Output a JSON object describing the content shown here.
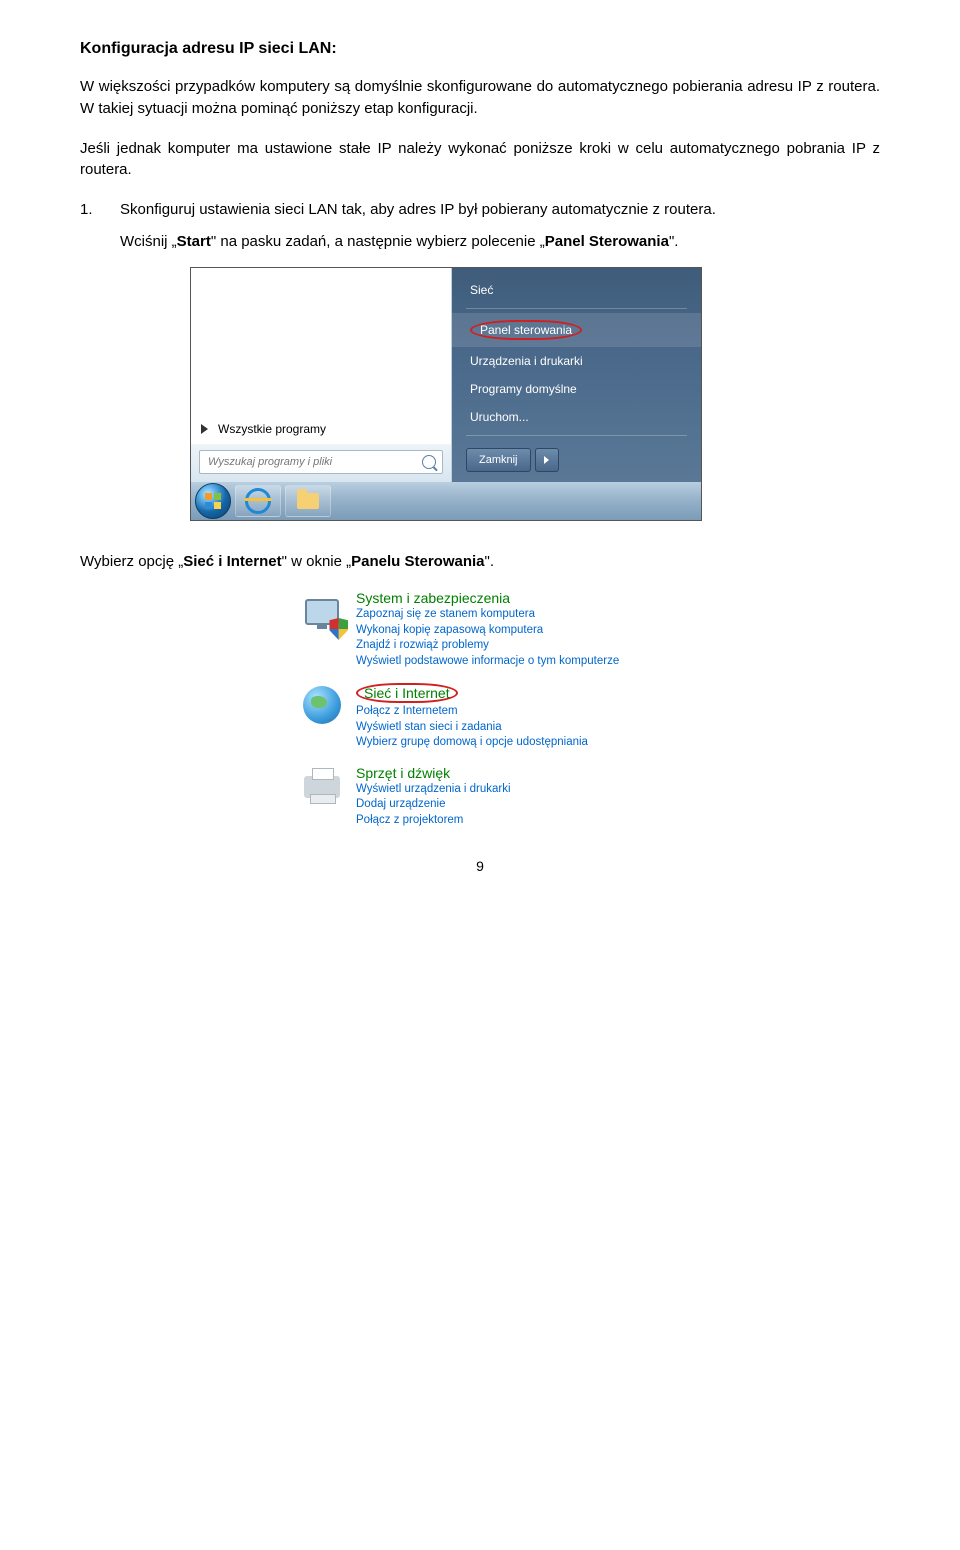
{
  "heading": "Konfiguracja adresu IP sieci LAN:",
  "para1": "W większości przypadków komputery są domyślnie skonfigurowane do automatycznego pobierania adresu IP z routera. W takiej sytuacji można pominąć poniższy etap konfiguracji.",
  "para2": "Jeśli jednak komputer ma ustawione stałe IP należy wykonać poniższe kroki w celu automatycznego pobrania IP z routera.",
  "step1_num": "1.",
  "step1_text": "Skonfiguruj ustawienia sieci LAN tak, aby adres IP był pobierany automatycznie z routera.",
  "step1_sub_pre": "Wciśnij „",
  "step1_sub_start": "Start",
  "step1_sub_mid": "\" na pasku zadań, a następnie wybierz polecenie „",
  "step1_sub_panel": "Panel Sterowania",
  "step1_sub_post": "\".",
  "startmenu": {
    "all_programs": "Wszystkie programy",
    "search_placeholder": "Wyszukaj programy i pliki",
    "right_items": {
      "siec": "Sieć",
      "panel": "Panel sterowania",
      "urz": "Urządzenia i drukarki",
      "prog": "Programy domyślne",
      "uruch": "Uruchom..."
    },
    "shutdown": "Zamknij"
  },
  "after_menu_pre": "Wybierz opcję „",
  "after_menu_bold": "Sieć i Internet",
  "after_menu_mid": "\" w oknie „",
  "after_menu_bold2": "Panelu Sterowania",
  "after_menu_post": "\".",
  "cp": {
    "sys": {
      "title": "System i zabezpieczenia",
      "l1": "Zapoznaj się ze stanem komputera",
      "l2": "Wykonaj kopię zapasową komputera",
      "l3": "Znajdź i rozwiąż problemy",
      "l4": "Wyświetl podstawowe informacje o tym komputerze"
    },
    "net": {
      "title": "Sieć i Internet",
      "l1": "Połącz z Internetem",
      "l2": "Wyświetl stan sieci i zadania",
      "l3": "Wybierz grupę domową i opcje udostępniania"
    },
    "hw": {
      "title": "Sprzęt i dźwięk",
      "l1": "Wyświetl urządzenia i drukarki",
      "l2": "Dodaj urządzenie",
      "l3": "Połącz z projektorem"
    }
  },
  "page_number": "9"
}
